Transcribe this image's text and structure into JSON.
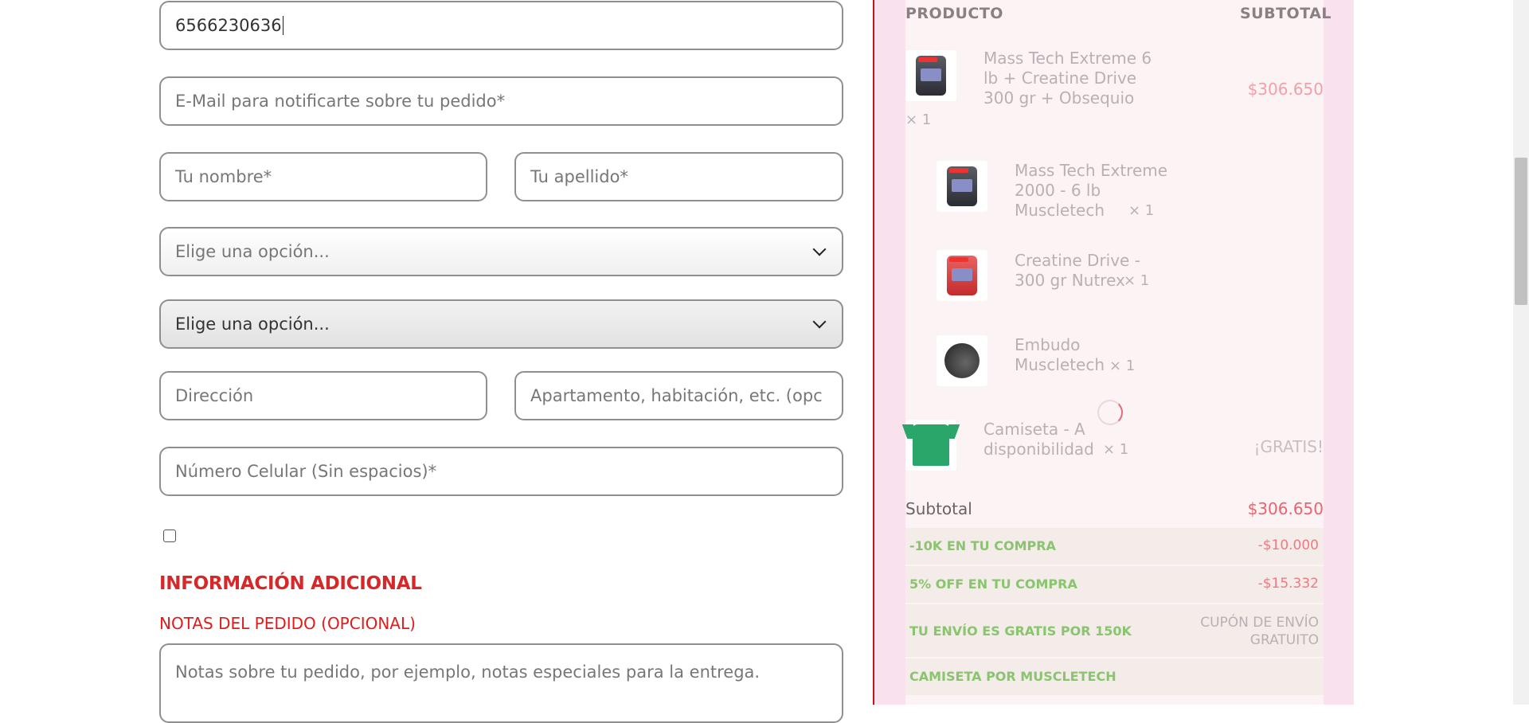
{
  "form": {
    "phone_value": "6566230636",
    "email_placeholder": "E-Mail para notificarte sobre tu pedido*",
    "first_name_placeholder": "Tu nombre*",
    "last_name_placeholder": "Tu apellido*",
    "select1_value": "Elige una opción...",
    "select2_value": "Elige una opción...",
    "address_placeholder": "Dirección",
    "apartment_placeholder": "Apartamento, habitación, etc. (opc",
    "mobile_placeholder": "Número Celular (Sin espacios)*",
    "additional_info_title": "INFORMACIÓN ADICIONAL",
    "notes_label": "NOTAS DEL PEDIDO (OPCIONAL)",
    "notes_placeholder": "Notas sobre tu pedido, por ejemplo, notas especiales para la entrega."
  },
  "summary": {
    "col_product": "PRODUCTO",
    "col_subtotal": "SUBTOTAL",
    "items": [
      {
        "name": "Mass Tech Extreme 6 lb + Creatine Drive 300 gr + Obsequio",
        "qty": "× 1",
        "price": "$306.650"
      },
      {
        "name": "Mass Tech Extreme 2000 - 6 lb Muscletech",
        "qty": "× 1"
      },
      {
        "name": "Creatine Drive - 300 gr Nutrex",
        "qty": "× 1"
      },
      {
        "name": "Embudo Muscletech",
        "qty": "× 1"
      },
      {
        "name": "Camiseta - A disponibilidad",
        "qty": "× 1",
        "price": "¡GRATIS!"
      }
    ],
    "subtotal_label": "Subtotal",
    "subtotal_value": "$306.650",
    "coupons": [
      {
        "name": "-10K EN TU COMPRA",
        "value": "-$10.000"
      },
      {
        "name": "5% OFF EN TU COMPRA",
        "value": "-$15.332"
      },
      {
        "name": "TU ENVÍO ES GRATIS POR 150K",
        "value": "CUPÓN DE ENVÍO GRATUITO"
      },
      {
        "name": "CAMISETA POR MUSCLETECH",
        "value": ""
      }
    ]
  },
  "colors": {
    "accent_red": "#d62828",
    "panel_pink": "#f9e2ee",
    "coupon_green": "#8ac46f"
  }
}
